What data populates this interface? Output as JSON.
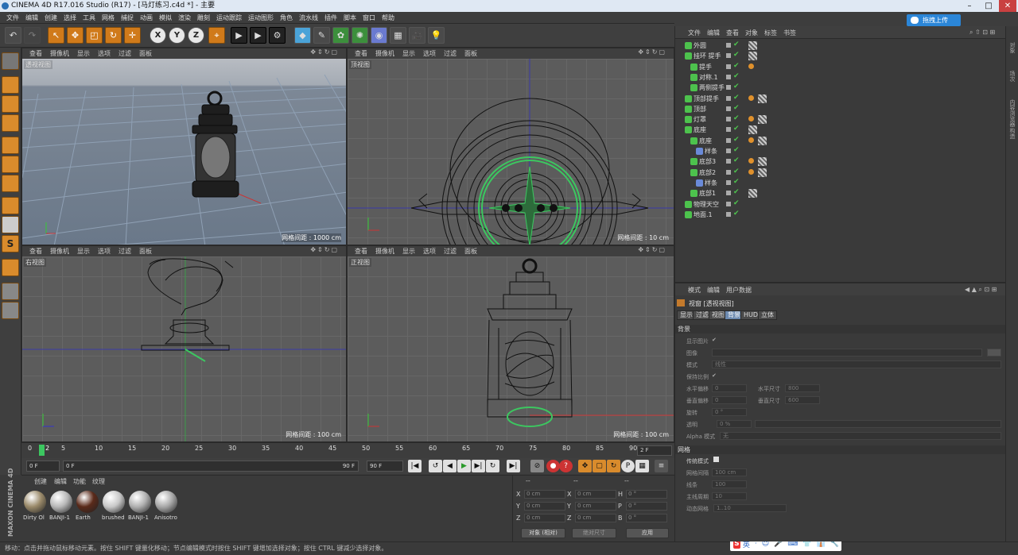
{
  "window": {
    "title": "CINEMA 4D R17.016 Studio (R17) - [马灯练习.c4d *] - 主要"
  },
  "menu": [
    "文件",
    "编辑",
    "创建",
    "选择",
    "工具",
    "网格",
    "捕捉",
    "动画",
    "模拟",
    "渲染",
    "雕刻",
    "运动跟踪",
    "运动图形",
    "角色",
    "流水线",
    "插件",
    "脚本",
    "窗口",
    "帮助"
  ],
  "upload_button": "拖拽上传",
  "toolbar": {
    "undo": "↶",
    "x": "X",
    "y": "Y",
    "z": "Z"
  },
  "viewports": [
    {
      "label": "透视视图",
      "grid": "网格间距 : 1000 cm"
    },
    {
      "label": "顶视图",
      "grid": "网格间距 : 10 cm"
    },
    {
      "label": "右视图",
      "grid": "网格间距 : 100 cm"
    },
    {
      "label": "正视图",
      "grid": "网格间距 : 100 cm"
    }
  ],
  "viewport_menu": [
    "查看",
    "摄像机",
    "显示",
    "选项",
    "过滤",
    "面板"
  ],
  "timeline": {
    "ticks": [
      "0",
      "5",
      "10",
      "15",
      "20",
      "25",
      "30",
      "35",
      "40",
      "45",
      "50",
      "55",
      "60",
      "65",
      "70",
      "75",
      "80",
      "85",
      "90"
    ],
    "current": "2",
    "end": "2 F"
  },
  "playbar": {
    "start": "0 F",
    "range_start": "0 F",
    "range_end": "90 F",
    "end": "90 F"
  },
  "materials": {
    "tabs": [
      "创建",
      "编辑",
      "功能",
      "纹理"
    ],
    "items": [
      {
        "name": "Dirty Ol",
        "color": "#9a8a6a"
      },
      {
        "name": "BANJI-1",
        "color": "#b8b8b8"
      },
      {
        "name": "Earth",
        "color": "#5a2a1a"
      },
      {
        "name": "brushed",
        "color": "#c8c8c8"
      },
      {
        "name": "BANJI-1",
        "color": "#b0b0b0"
      },
      {
        "name": "Anisotro",
        "color": "#a8a8a8"
      }
    ]
  },
  "coords": {
    "head": [
      "--",
      "--",
      "--"
    ],
    "rows": [
      {
        "a": "X",
        "av": "0 cm",
        "b": "X",
        "bv": "0 cm",
        "c": "H",
        "cv": "0 °"
      },
      {
        "a": "Y",
        "av": "0 cm",
        "b": "Y",
        "bv": "0 cm",
        "c": "P",
        "cv": "0 °"
      },
      {
        "a": "Z",
        "av": "0 cm",
        "b": "Z",
        "bv": "0 cm",
        "c": "B",
        "cv": "0 °"
      }
    ],
    "mode": "对象 (相对)",
    "size": "绝对尺寸",
    "apply": "应用"
  },
  "maxon": "MAXON CINEMA 4D",
  "status": "移动：点击并拖动鼠标移动元素。按住 SHIFT 键量化移动；节点编辑模式时按住 SHIFT 键增加选择对象；按住 CTRL 键减少选择对象。",
  "ime": {
    "s": "S",
    "items": [
      "英",
      "·",
      "☺",
      "🎤",
      "⌨",
      "👕",
      "👔",
      "🔧"
    ]
  },
  "objects": {
    "menu": [
      "文件",
      "编辑",
      "查看",
      "对象",
      "标签",
      "书签"
    ],
    "rows": [
      {
        "name": "外圆",
        "indent": 0,
        "tags": "tex"
      },
      {
        "name": "挂环 提手",
        "indent": 0,
        "tags": "tex"
      },
      {
        "name": "提手",
        "indent": 1,
        "tags": "dot"
      },
      {
        "name": "对称.1",
        "indent": 1,
        "tags": ""
      },
      {
        "name": "两侧提手",
        "indent": 1,
        "tags": ""
      },
      {
        "name": "顶部提手",
        "indent": 0,
        "tags": "dottex"
      },
      {
        "name": "顶部",
        "indent": 0,
        "tags": ""
      },
      {
        "name": "灯罩",
        "indent": 0,
        "tags": "dottex"
      },
      {
        "name": "底座",
        "indent": 0,
        "tags": "tex"
      },
      {
        "name": "底座",
        "indent": 1,
        "tags": "dottex"
      },
      {
        "name": "样条",
        "indent": 2,
        "tags": ""
      },
      {
        "name": "底部3",
        "indent": 1,
        "tags": "dottex"
      },
      {
        "name": "底部2",
        "indent": 1,
        "tags": "dottex"
      },
      {
        "name": "样条",
        "indent": 2,
        "tags": ""
      },
      {
        "name": "底部1",
        "indent": 1,
        "tags": "tex"
      },
      {
        "name": "物理天空",
        "indent": 0,
        "tags": ""
      },
      {
        "name": "地面.1",
        "indent": 0,
        "tags": ""
      }
    ]
  },
  "right_strip": [
    "对象",
    "场次",
    "内容浏览器",
    "构造"
  ],
  "attributes": {
    "menu": [
      "模式",
      "编辑",
      "用户数据"
    ],
    "title": "视窗 [透视视图]",
    "tabs": [
      "显示",
      "过滤",
      "视图",
      "背景",
      "HUD",
      "立体"
    ],
    "active_tab": "背景",
    "section1": "背景",
    "fields": {
      "show_image": "显示图片",
      "image": "图像",
      "mode": "模式",
      "mode_val": "线性",
      "keep_ratio": "保持比例",
      "h_offset": "水平偏移",
      "h_offset_val": "0",
      "h_size": "水平尺寸",
      "h_size_val": "800",
      "v_offset": "垂直偏移",
      "v_offset_val": "0",
      "v_size": "垂直尺寸",
      "v_size_val": "600",
      "rotate": "旋转",
      "rotate_val": "0 °",
      "transparency": "透明",
      "transparency_val": "0 %",
      "alpha": "Alpha 模式",
      "alpha_val": "无"
    },
    "section2": "网格",
    "grid": {
      "legacy": "传统模式",
      "spacing": "网格间隔",
      "spacing_val": "100 cm",
      "lines": "线条",
      "lines_val": "100",
      "major": "主线周期",
      "major_val": "10",
      "dynamic": "动态网格",
      "dynamic_val": "1..10"
    }
  }
}
